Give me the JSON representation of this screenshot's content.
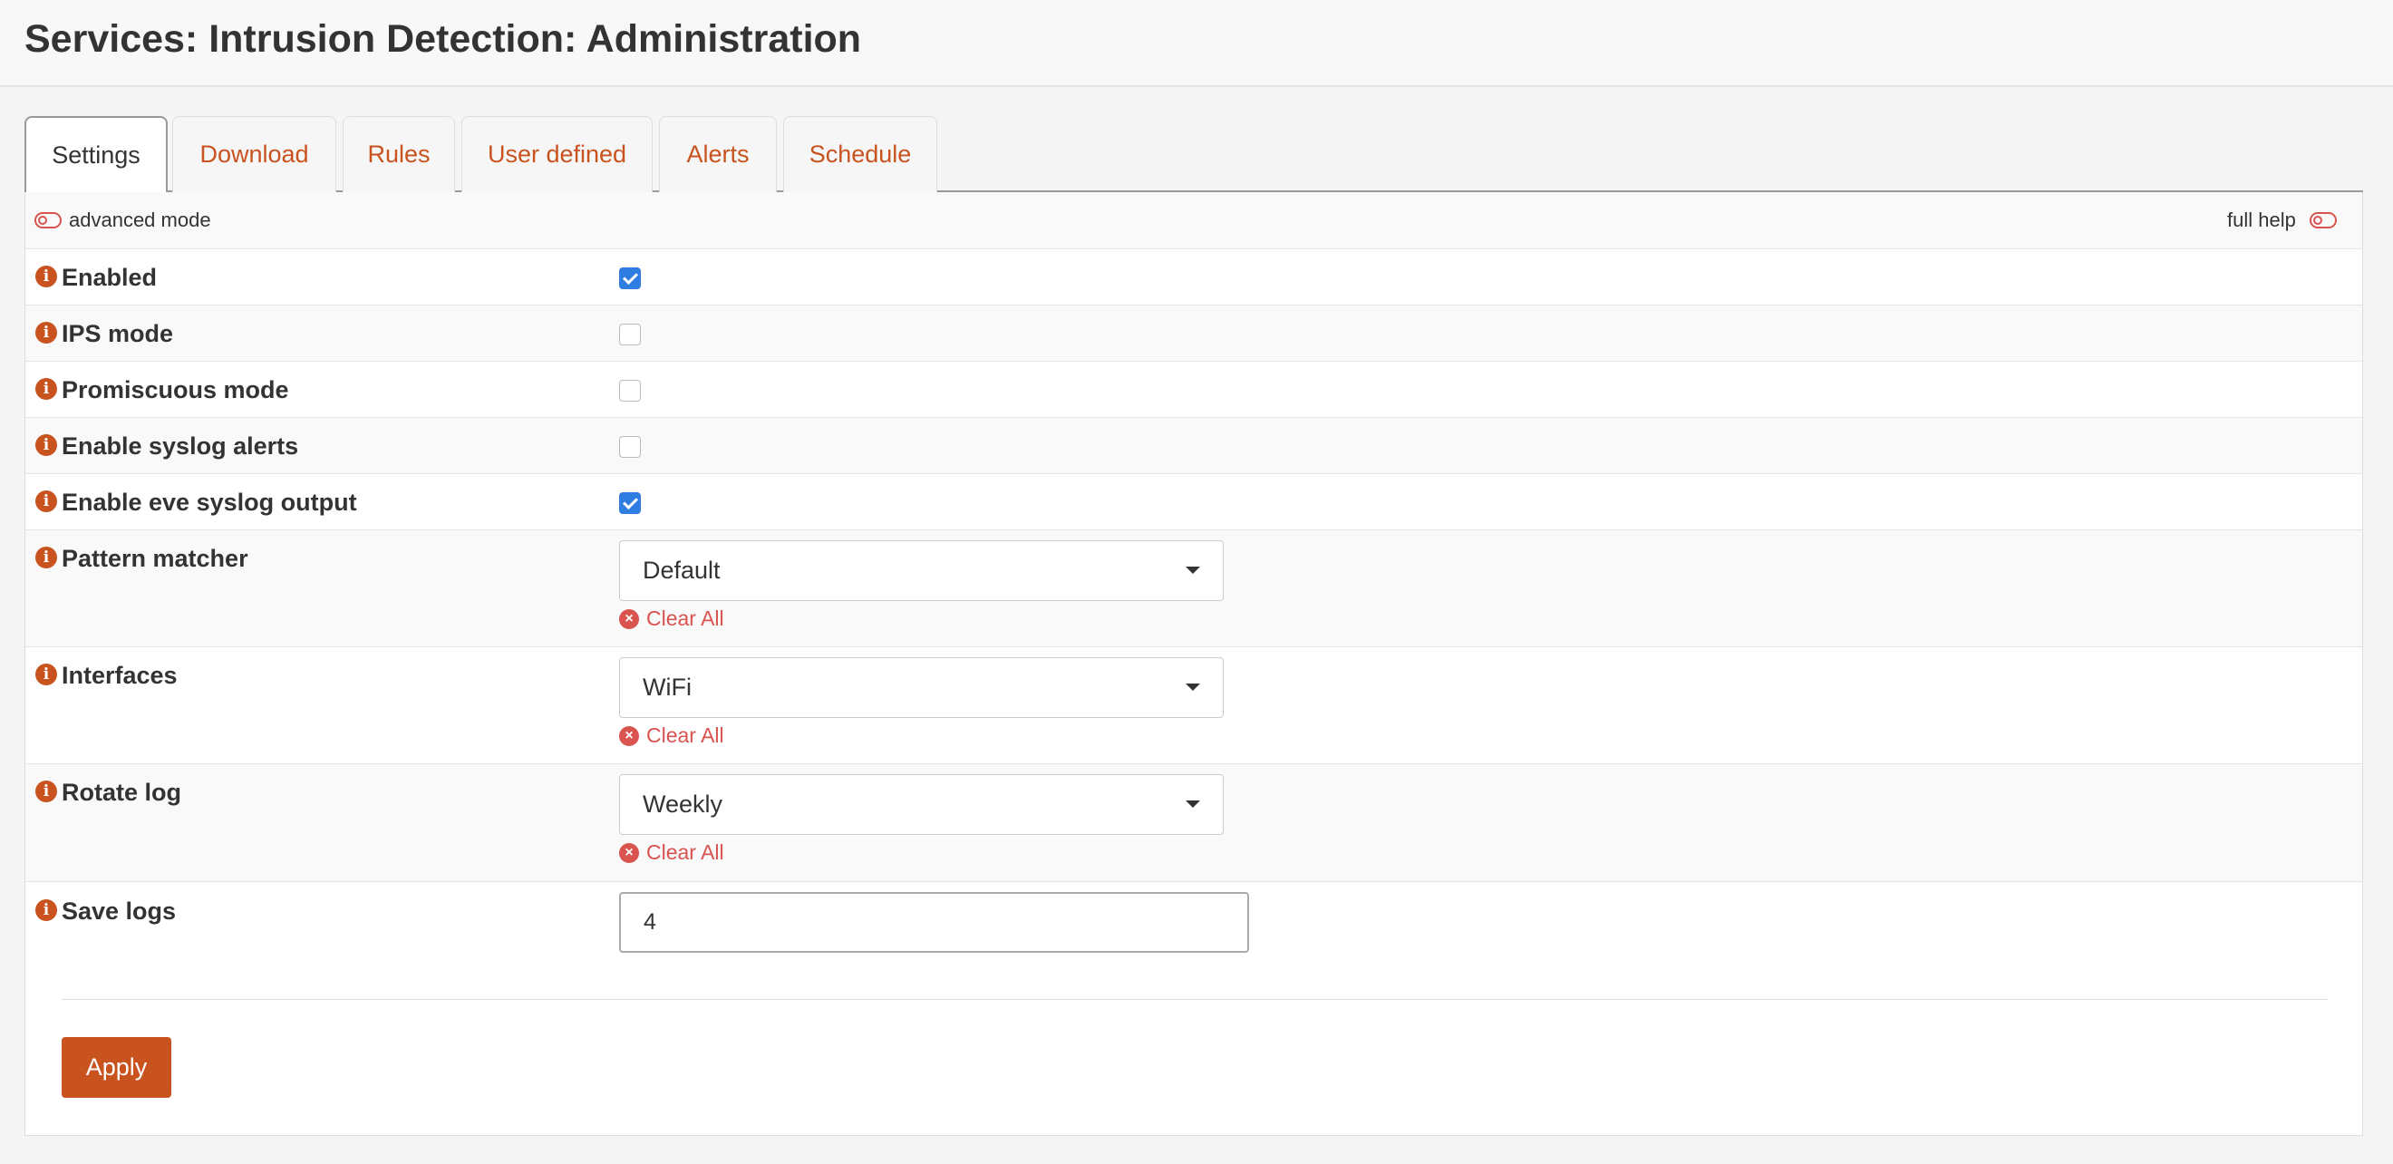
{
  "page": {
    "title": "Services: Intrusion Detection: Administration"
  },
  "tabs": [
    {
      "label": "Settings",
      "active": true
    },
    {
      "label": "Download",
      "active": false
    },
    {
      "label": "Rules",
      "active": false
    },
    {
      "label": "User defined",
      "active": false
    },
    {
      "label": "Alerts",
      "active": false
    },
    {
      "label": "Schedule",
      "active": false
    }
  ],
  "mode_bar": {
    "advanced_label": "advanced mode",
    "help_label": "full help"
  },
  "settings": {
    "enabled": {
      "label": "Enabled",
      "checked": true
    },
    "ips_mode": {
      "label": "IPS mode",
      "checked": false
    },
    "promiscuous_mode": {
      "label": "Promiscuous mode",
      "checked": false
    },
    "syslog_alerts": {
      "label": "Enable syslog alerts",
      "checked": false
    },
    "eve_syslog": {
      "label": "Enable eve syslog output",
      "checked": true
    },
    "pattern_matcher": {
      "label": "Pattern matcher",
      "value": "Default",
      "clear_label": "Clear All"
    },
    "interfaces": {
      "label": "Interfaces",
      "value": "WiFi",
      "clear_label": "Clear All"
    },
    "rotate_log": {
      "label": "Rotate log",
      "value": "Weekly",
      "clear_label": "Clear All"
    },
    "save_logs": {
      "label": "Save logs",
      "value": "4"
    }
  },
  "actions": {
    "apply_label": "Apply"
  },
  "colors": {
    "accent": "#c8531f",
    "checkbox_checked": "#2f7de1",
    "clear": "#d9534f"
  },
  "icons": {
    "info": "info-icon",
    "clear": "clear-icon",
    "toggle": "toggle-icon",
    "dropdown": "chevron-down-icon"
  }
}
